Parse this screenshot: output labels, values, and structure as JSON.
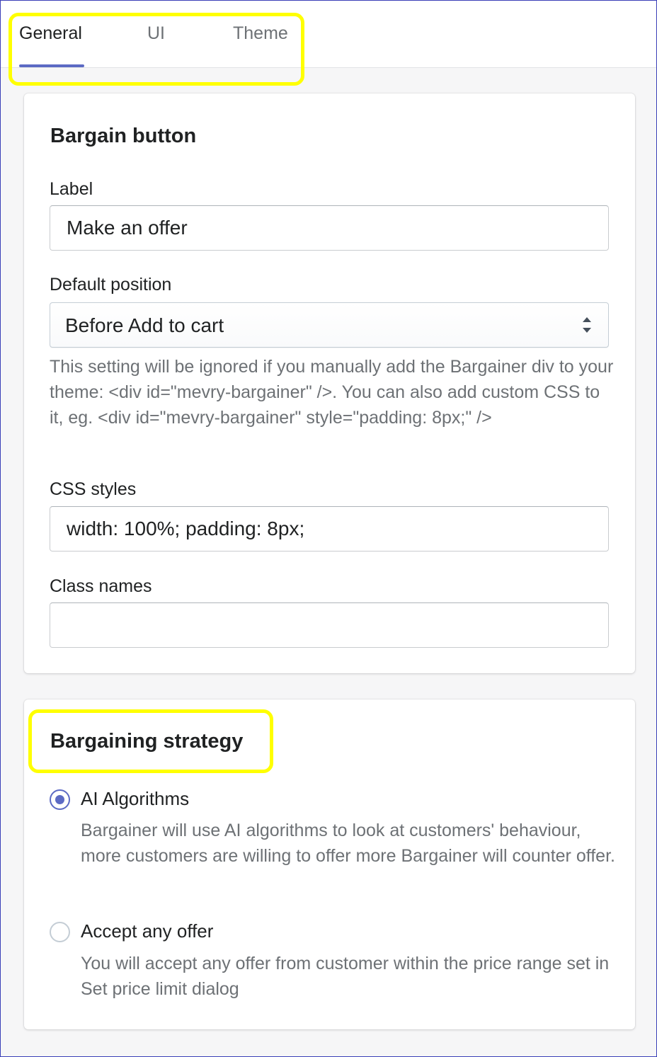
{
  "tabs": [
    {
      "label": "General",
      "active": true
    },
    {
      "label": "UI",
      "active": false
    },
    {
      "label": "Theme",
      "active": false
    }
  ],
  "bargain_button": {
    "title": "Bargain button",
    "label_field": {
      "label": "Label",
      "value": "Make an offer"
    },
    "position_field": {
      "label": "Default position",
      "value": "Before Add to cart",
      "help": "This setting will be ignored if you manually add the Bargainer div to your theme: <div id=\"mevry-bargainer\" />. You can also add custom CSS to it, eg. <div id=\"mevry-bargainer\" style=\"padding: 8px;\" />"
    },
    "css_field": {
      "label": "CSS styles",
      "value": "width: 100%; padding: 8px;"
    },
    "class_field": {
      "label": "Class names",
      "value": ""
    }
  },
  "bargaining_strategy": {
    "title": "Bargaining strategy",
    "options": [
      {
        "label": "AI Algorithms",
        "checked": true,
        "help": "Bargainer will use AI algorithms to look at customers' behaviour, more customers are willing to offer more Bargainer will counter offer."
      },
      {
        "label": "Accept any offer",
        "checked": false,
        "help": "You will accept any offer from customer within the price range set in Set price limit dialog"
      }
    ]
  },
  "colors": {
    "accent": "#5c6ac4",
    "highlight": "#ffff00",
    "text": "#202223",
    "subdued_text": "#6d7175"
  },
  "icons": {
    "select_arrows": "select-arrows-icon"
  }
}
